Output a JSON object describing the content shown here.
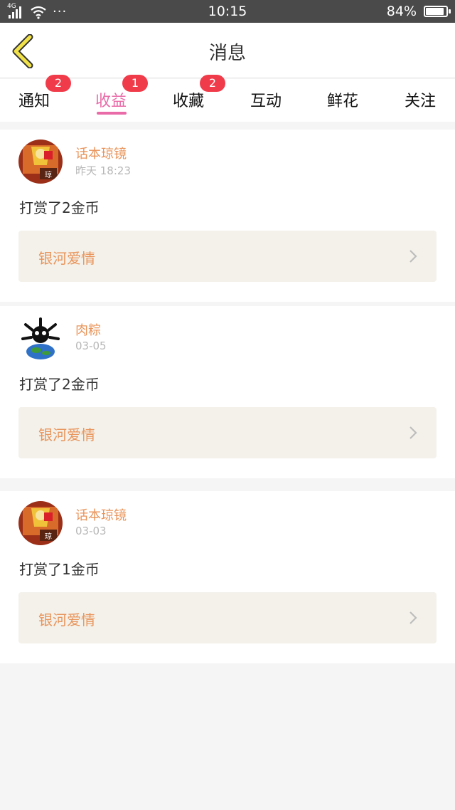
{
  "status_bar": {
    "network": "4G",
    "more": "···",
    "time": "10:15",
    "battery": "84%",
    "battery_level": 0.84,
    "color": "#4a4a4a"
  },
  "header": {
    "back_icon": "chevron-left-icon",
    "title": "消息"
  },
  "tabs": [
    {
      "label": "通知",
      "badge": "2",
      "active": false
    },
    {
      "label": "收益",
      "badge": "1",
      "active": true
    },
    {
      "label": "收藏",
      "badge": "2",
      "active": false
    },
    {
      "label": "互动",
      "badge": "",
      "active": false
    },
    {
      "label": "鲜花",
      "badge": "",
      "active": false
    },
    {
      "label": "关注",
      "badge": "",
      "active": false
    }
  ],
  "messages": [
    {
      "user": "话本琼镜",
      "time": "昨天 18:23",
      "text": "打赏了2金币",
      "book": "银河爱情",
      "avatar": "book-cover-avatar"
    },
    {
      "user": "肉粽",
      "time": "03-05",
      "text": "打赏了2金币",
      "book": "银河爱情",
      "avatar": "bone-skull-avatar"
    },
    {
      "user": "话本琼镜",
      "time": "03-03",
      "text": "打赏了1金币",
      "book": "银河爱情",
      "avatar": "book-cover-avatar"
    }
  ],
  "colors": {
    "accent_pink": "#e96ba8",
    "name_orange": "#e9945a",
    "badge_red": "#f03c4a",
    "book_bg": "#f3f1ea",
    "page_bg": "#f5f5f5"
  }
}
